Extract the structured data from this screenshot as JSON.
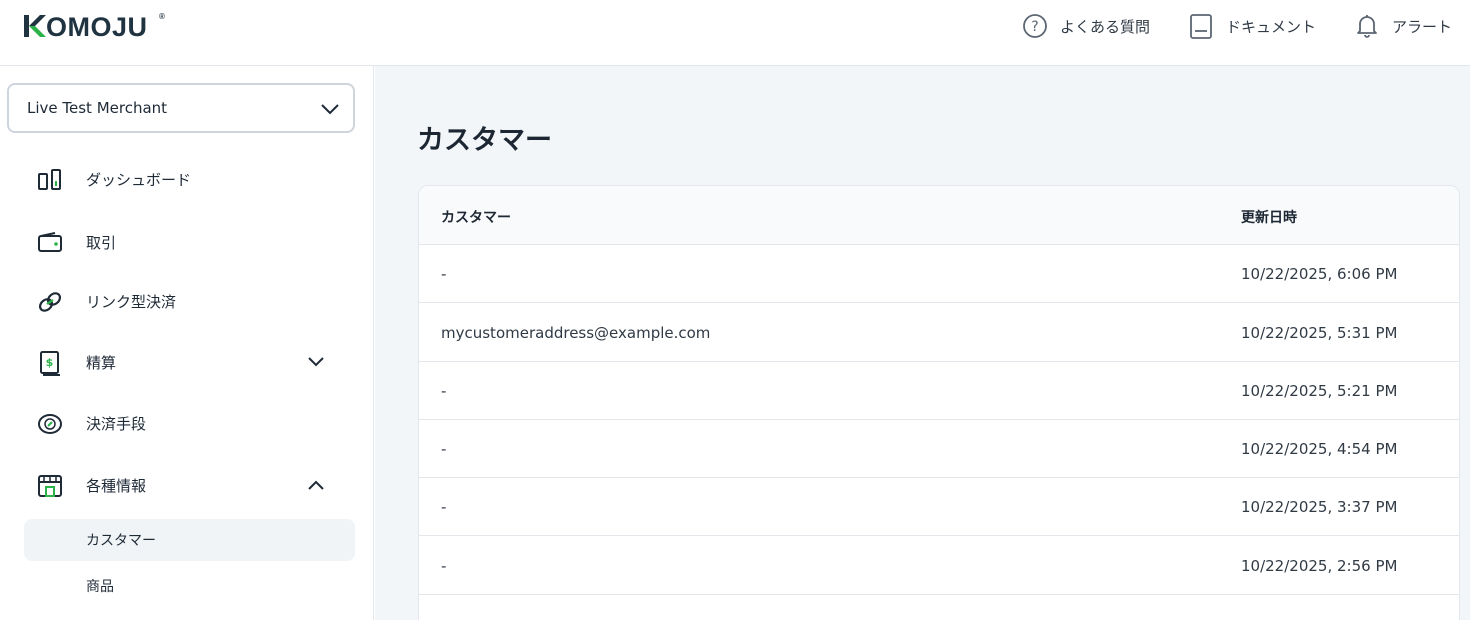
{
  "app": {
    "logo": "KOMOJU"
  },
  "header": {
    "links": [
      {
        "label": "よくある質問",
        "icon": "question-circle-icon"
      },
      {
        "label": "ドキュメント",
        "icon": "document-icon"
      },
      {
        "label": "アラート",
        "icon": "bell-icon"
      }
    ]
  },
  "sidebar": {
    "merchant": "Live Test Merchant",
    "items": [
      {
        "label": "ダッシュボード",
        "icon": "dashboard-icon"
      },
      {
        "label": "取引",
        "icon": "wallet-icon"
      },
      {
        "label": "リンク型決済",
        "icon": "link-icon"
      },
      {
        "label": "精算",
        "icon": "settlement-icon",
        "expanded": false
      },
      {
        "label": "決済手段",
        "icon": "payment-method-icon"
      },
      {
        "label": "各種情報",
        "icon": "store-icon",
        "expanded": true
      }
    ],
    "sub_items": [
      {
        "label": "カスタマー",
        "active": true
      },
      {
        "label": "商品",
        "active": false
      }
    ]
  },
  "main": {
    "title": "カスタマー",
    "table": {
      "headers": [
        "カスタマー",
        "更新日時"
      ],
      "rows": [
        {
          "customer": "-",
          "updated": "10/22/2025, 6:06 PM"
        },
        {
          "customer": "mycustomeraddress@example.com",
          "updated": "10/22/2025, 5:31 PM"
        },
        {
          "customer": "-",
          "updated": "10/22/2025, 5:21 PM"
        },
        {
          "customer": "-",
          "updated": "10/22/2025, 4:54 PM"
        },
        {
          "customer": "-",
          "updated": "10/22/2025, 3:37 PM"
        },
        {
          "customer": "-",
          "updated": "10/22/2025, 2:56 PM"
        }
      ]
    }
  },
  "colors": {
    "brand_green": "#2bb34a",
    "text_dark": "#1c2733",
    "main_bg": "#f3f6f8",
    "border": "#e3e7ec"
  }
}
